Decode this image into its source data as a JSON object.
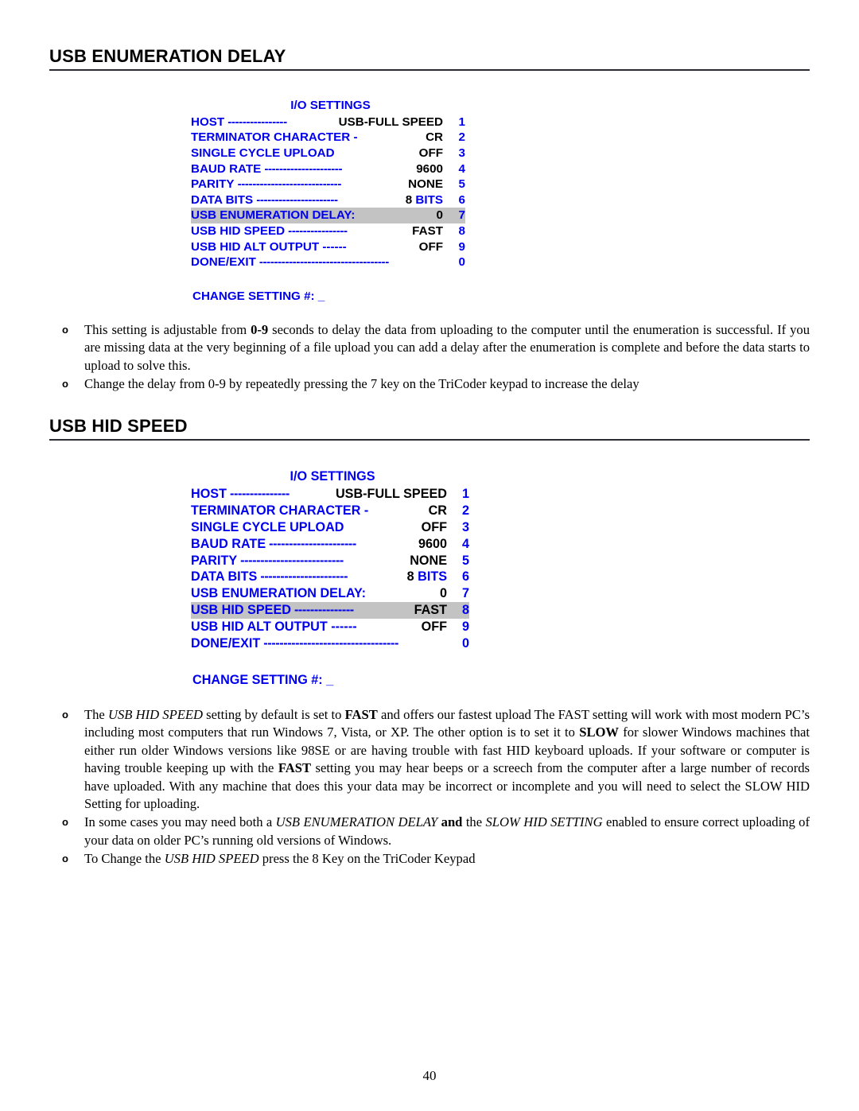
{
  "document": {
    "page_number": "40"
  },
  "sections": [
    {
      "heading": "USB ENUMERATION DELAY",
      "menu": {
        "title": "I/O SETTINGS",
        "change_prompt": "CHANGE SETTING #:",
        "cursor": "_",
        "rows": [
          {
            "label": "HOST",
            "dashes": "----------------",
            "value": "USB-FULL SPEED",
            "value_color": "#000000",
            "number": "1",
            "highlighted": false
          },
          {
            "label": "TERMINATOR CHARACTER  -",
            "dashes": "",
            "value": "CR",
            "value_color": "#000000",
            "number": "2",
            "highlighted": false
          },
          {
            "label": "SINGLE CYCLE UPLOAD",
            "dashes": "",
            "value": "OFF",
            "value_color": "#000000",
            "number": "3",
            "highlighted": false
          },
          {
            "label": "BAUD RATE",
            "dashes": "---------------------",
            "value": "9600",
            "value_color": "#000000",
            "number": "4",
            "highlighted": false
          },
          {
            "label": "PARITY",
            "dashes": "----------------------------",
            "value": "NONE",
            "value_color": "#000000",
            "number": "5",
            "highlighted": false
          },
          {
            "label": "DATA BITS",
            "dashes": "----------------------",
            "value_parts": [
              {
                "text": "8 ",
                "color": "#000000"
              },
              {
                "text": "BITS",
                "color": "#0000ee"
              }
            ],
            "number": "6",
            "highlighted": false
          },
          {
            "label": "USB ENUMERATION DELAY:",
            "dashes": "",
            "value": "0",
            "value_color": "#000000",
            "value_align": "left",
            "number": "7",
            "highlighted": true
          },
          {
            "label": "USB HID SPEED",
            "dashes": "----------------",
            "value": "FAST",
            "value_color": "#000000",
            "number": "8",
            "highlighted": false
          },
          {
            "label": "USB HID ALT OUTPUT ------",
            "dashes": "",
            "value": "OFF",
            "value_color": "#000000",
            "number": "9",
            "highlighted": false
          },
          {
            "label": "DONE/EXIT",
            "dashes": "-----------------------------------",
            "value": "",
            "value_color": "#000000",
            "number": "0",
            "highlighted": false
          }
        ]
      },
      "bullets": [
        [
          {
            "text": "This setting is adjustable from ",
            "style": "normal"
          },
          {
            "text": "0-9",
            "style": "bold"
          },
          {
            "text": " seconds to delay the data from uploading to the computer until the enumeration is successful.  If you are missing data at the very beginning of a file upload you can add a delay after the enumeration is complete and before the data starts to upload to solve this.",
            "style": "normal"
          }
        ],
        [
          {
            "text": "Change the delay from 0-9 by repeatedly pressing the 7 key on the TriCoder keypad to increase the delay",
            "style": "normal"
          }
        ]
      ]
    },
    {
      "heading": "USB HID SPEED",
      "menu": {
        "title": "I/O SETTINGS",
        "change_prompt": "CHANGE SETTING #:",
        "cursor": "_",
        "rows": [
          {
            "label": "HOST",
            "dashes": "---------------",
            "value": "USB-FULL SPEED",
            "value_color": "#000000",
            "number": "1",
            "highlighted": false
          },
          {
            "label": "TERMINATOR CHARACTER  -",
            "dashes": "",
            "value": "CR",
            "value_color": "#000000",
            "number": "2",
            "highlighted": false
          },
          {
            "label": "SINGLE CYCLE UPLOAD",
            "dashes": "",
            "value": "OFF",
            "value_color": "#000000",
            "number": "3",
            "highlighted": false
          },
          {
            "label": "BAUD RATE",
            "dashes": "----------------------",
            "value": "9600",
            "value_color": "#000000",
            "number": "4",
            "highlighted": false
          },
          {
            "label": "PARITY",
            "dashes": "--------------------------",
            "value": "NONE",
            "value_color": "#000000",
            "number": "5",
            "highlighted": false
          },
          {
            "label": "DATA BITS",
            "dashes": "----------------------",
            "value_parts": [
              {
                "text": "8 ",
                "color": "#000000"
              },
              {
                "text": "BITS",
                "color": "#0000ee"
              }
            ],
            "number": "6",
            "highlighted": false
          },
          {
            "label": "USB ENUMERATION DELAY:",
            "dashes": "",
            "value": "0",
            "value_color": "#000000",
            "value_align": "left",
            "number": "7",
            "highlighted": false
          },
          {
            "label": "USB HID SPEED",
            "dashes": "---------------",
            "value": "FAST",
            "value_color": "#000000",
            "number": "8",
            "highlighted": true
          },
          {
            "label": "USB HID ALT OUTPUT ------",
            "dashes": "",
            "value": "OFF",
            "value_color": "#000000",
            "number": "9",
            "highlighted": false
          },
          {
            "label": "DONE/EXIT",
            "dashes": "----------------------------------",
            "value": "",
            "value_color": "#000000",
            "number": "0",
            "highlighted": false
          }
        ]
      },
      "bullets": [
        [
          {
            "text": "The ",
            "style": "normal"
          },
          {
            "text": "USB HID SPEED",
            "style": "italic"
          },
          {
            "text": " setting by default is set to ",
            "style": "normal"
          },
          {
            "text": "FAST",
            "style": "bold"
          },
          {
            "text": " and offers our fastest upload The FAST setting will work with most modern PC’s including most computers that run Windows 7, Vista, or XP.  The other option is to set it to ",
            "style": "normal"
          },
          {
            "text": "SLOW",
            "style": "bold"
          },
          {
            "text": " for slower Windows machines that either run older Windows versions like 98SE or are having trouble with fast HID keyboard uploads.  If your software or computer is having trouble keeping up with the ",
            "style": "normal"
          },
          {
            "text": "FAST",
            "style": "bold"
          },
          {
            "text": " setting you may hear beeps or a screech from the computer after a large number of records have uploaded.  With any machine that does this your data may be incorrect or incomplete and you will need to select the SLOW HID Setting for uploading.",
            "style": "normal"
          }
        ],
        [
          {
            "text": "In some cases you may need both a ",
            "style": "normal"
          },
          {
            "text": "USB ENUMERATION DELAY",
            "style": "italic"
          },
          {
            "text": " and",
            "style": "bold"
          },
          {
            "text": " the ",
            "style": "normal"
          },
          {
            "text": "SLOW HID SETTING",
            "style": "italic"
          },
          {
            "text": " enabled to ensure correct uploading of your data on older PC’s running old versions of Windows.",
            "style": "normal"
          }
        ],
        [
          {
            "text": "To Change the ",
            "style": "normal"
          },
          {
            "text": "USB HID SPEED",
            "style": "italic"
          },
          {
            "text": " press the 8 Key on the TriCoder Keypad",
            "style": "normal"
          }
        ]
      ]
    }
  ]
}
